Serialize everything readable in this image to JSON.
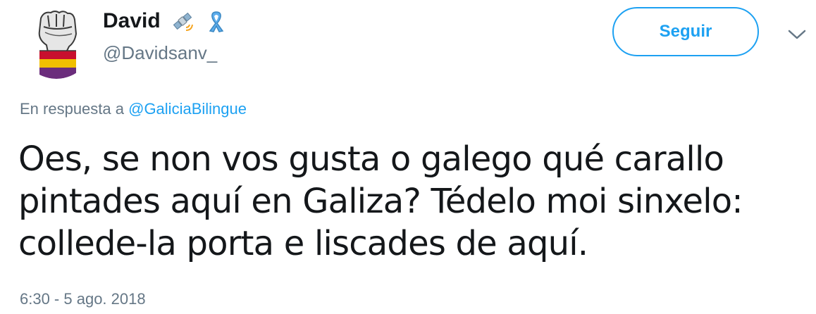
{
  "user": {
    "display_name": "David",
    "handle": "@Davidsanv_",
    "name_emojis": [
      "satellite-icon",
      "blue-ribbon-icon"
    ]
  },
  "follow_button": {
    "label": "Seguir"
  },
  "menu": {
    "icon": "chevron-down-icon"
  },
  "reply": {
    "prefix": "En respuesta a",
    "mention": "@GaliciaBilingue"
  },
  "tweet": {
    "lines": [
      "Oes, se non vos gusta o galego qué carallo",
      "pintades aquí en Galiza? Tédelo moi sinxelo:",
      "collede-la porta e liscades de aquí."
    ],
    "timestamp": "6:30 - 5 ago. 2018"
  },
  "colors": {
    "accent": "#1da1f2",
    "secondary_text": "#657786",
    "primary_text": "#14171a"
  }
}
